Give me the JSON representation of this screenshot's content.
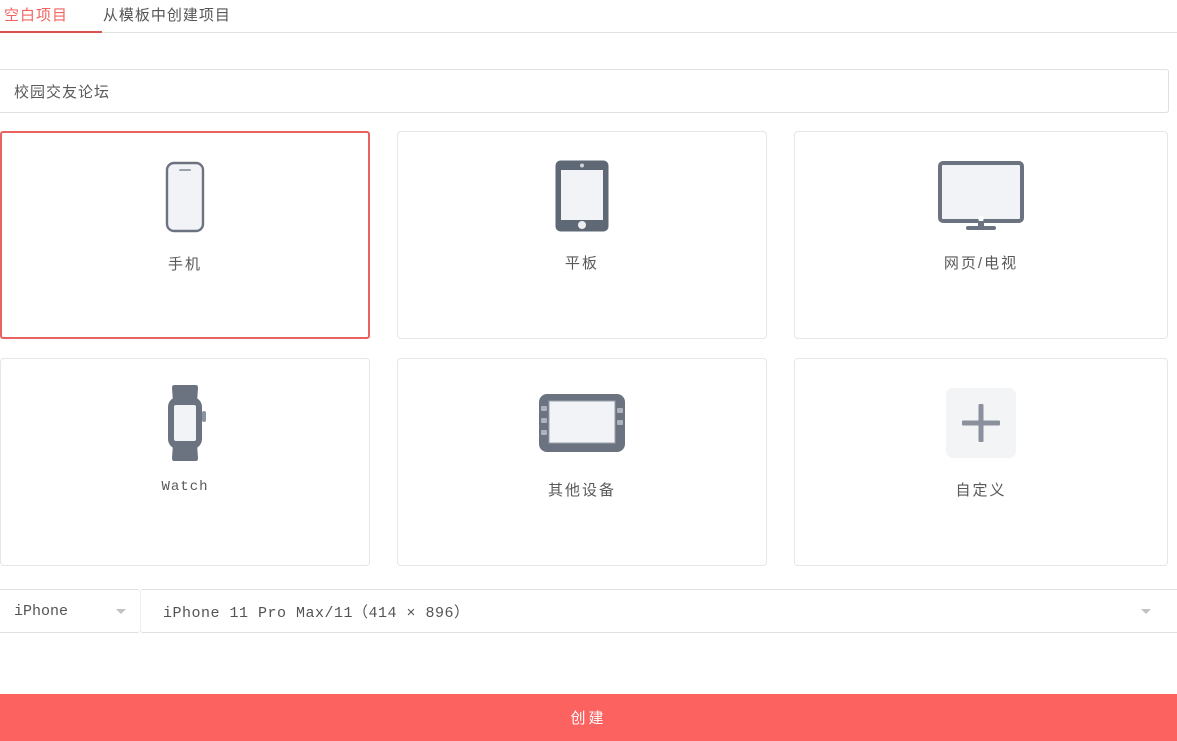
{
  "tabs": [
    {
      "label": "空白项目",
      "active": true
    },
    {
      "label": "从模板中创建项目",
      "active": false
    }
  ],
  "project_name": {
    "value": "校园交友论坛",
    "placeholder": "请输入项目名称"
  },
  "devices": [
    {
      "label": "手机",
      "icon": "phone-icon",
      "selected": true,
      "mono": false
    },
    {
      "label": "平板",
      "icon": "tablet-icon",
      "selected": false,
      "mono": false
    },
    {
      "label": "网页/电视",
      "icon": "monitor-icon",
      "selected": false,
      "mono": false
    },
    {
      "label": "Watch",
      "icon": "watch-icon",
      "selected": false,
      "mono": true
    },
    {
      "label": "其他设备",
      "icon": "device-icon",
      "selected": false,
      "mono": false
    },
    {
      "label": "自定义",
      "icon": "plus-icon",
      "selected": false,
      "mono": false
    }
  ],
  "selects": {
    "brand": {
      "value": "iPhone"
    },
    "model": {
      "value": "iPhone 11 Pro Max/11（414 × 896）"
    }
  },
  "create_button": {
    "label": "创建"
  },
  "colors": {
    "accent": "#fb6260",
    "tab_active": "#f2635f",
    "selected_border": "#e8635f",
    "icon_gray": "#6b7280",
    "card_border": "#e6e6e6"
  }
}
